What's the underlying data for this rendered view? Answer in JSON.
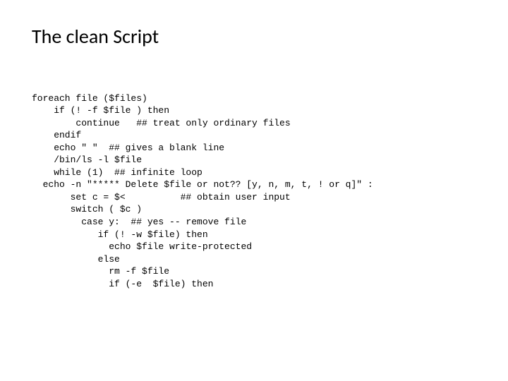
{
  "title": "The clean Script",
  "code": {
    "l1": "foreach file ($files)",
    "l2": "    if (! -f $file ) then",
    "l3": "        continue   ## treat only ordinary files",
    "l4": "    endif",
    "l5": "    echo \" \"  ## gives a blank line",
    "l6": "    /bin/ls -l $file",
    "l7": "    while (1)  ## infinite loop",
    "l8": "  echo -n \"***** Delete $file or not?? [y, n, m, t, ! or q]\" :",
    "l9": "       set c = $<          ## obtain user input",
    "l10": "       switch ( $c )",
    "l11": "         case y:  ## yes -- remove file",
    "l12": "            if (! -w $file) then",
    "l13": "              echo $file write-protected",
    "l14": "            else",
    "l15": "              rm -f $file",
    "l16": "              if (-e  $file) then"
  }
}
